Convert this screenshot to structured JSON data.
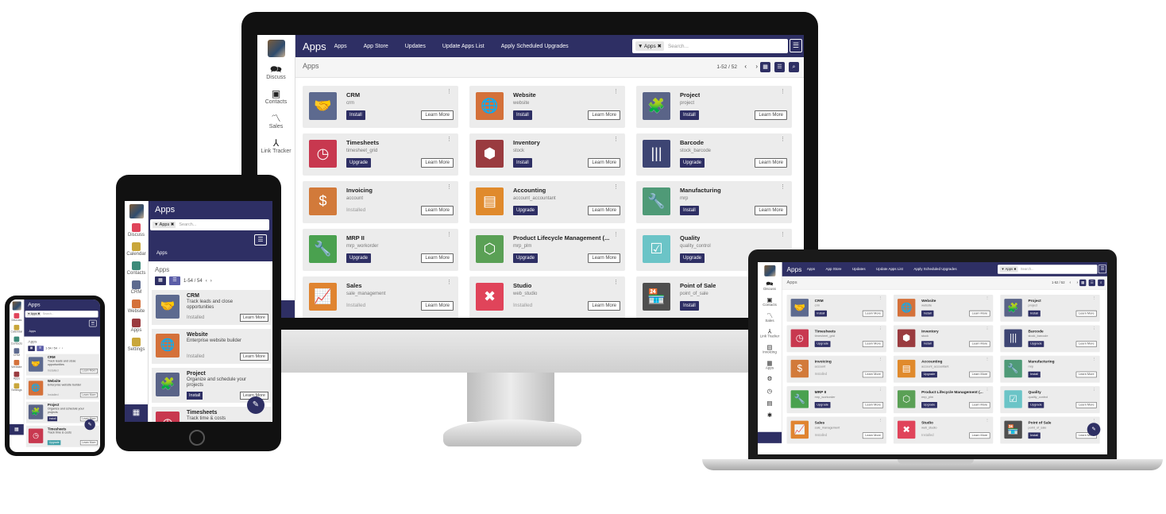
{
  "desktop": {
    "brand": "Apps",
    "nav": [
      "Apps",
      "App Store",
      "Updates",
      "Update Apps List",
      "Apply Scheduled Upgrades"
    ],
    "search_facet": "▼ Apps ✖",
    "search_placeholder": "Search...",
    "breadcrumb": "Apps",
    "pager": "1-52 / 52",
    "sidebar": [
      {
        "label": "Discuss",
        "icon": "discuss-icon",
        "glyph": "🗪"
      },
      {
        "label": "Contacts",
        "icon": "contacts-icon",
        "glyph": "▣"
      },
      {
        "label": "Sales",
        "icon": "sales-icon",
        "glyph": "〽"
      },
      {
        "label": "Link Tracker",
        "icon": "link-tracker-icon",
        "glyph": "⅄"
      }
    ],
    "cards": [
      {
        "name": "CRM",
        "tech": "crm",
        "action": "Install",
        "color": "#5d6a8f",
        "glyph": "🤝"
      },
      {
        "name": "Website",
        "tech": "website",
        "action": "Install",
        "color": "#d4713a",
        "glyph": "🌐"
      },
      {
        "name": "Project",
        "tech": "project",
        "action": "Install",
        "color": "#5a6488",
        "glyph": "🧩"
      },
      {
        "name": "Timesheets",
        "tech": "timesheet_grid",
        "action": "Upgrade",
        "color": "#c8384f",
        "glyph": "◷"
      },
      {
        "name": "Inventory",
        "tech": "stock",
        "action": "Install",
        "color": "#9a3b3f",
        "glyph": "⬢"
      },
      {
        "name": "Barcode",
        "tech": "stock_barcode",
        "action": "Upgrade",
        "color": "#3d4573",
        "glyph": "|||"
      },
      {
        "name": "Invoicing",
        "tech": "account",
        "action": "Installed",
        "color": "#d27a3a",
        "glyph": "$"
      },
      {
        "name": "Accounting",
        "tech": "account_accountant",
        "action": "Upgrade",
        "color": "#e08a2c",
        "glyph": "▤"
      },
      {
        "name": "Manufacturing",
        "tech": "mrp",
        "action": "Install",
        "color": "#4f9a77",
        "glyph": "🔧"
      },
      {
        "name": "MRP II",
        "tech": "mrp_workorder",
        "action": "Upgrade",
        "color": "#4aa14f",
        "glyph": "🔧"
      },
      {
        "name": "Product Lifecycle Management (...",
        "tech": "mrp_plm",
        "action": "Upgrade",
        "color": "#5aa055",
        "glyph": "⬡"
      },
      {
        "name": "Quality",
        "tech": "quality_control",
        "action": "Upgrade",
        "color": "#6bc4c7",
        "glyph": "☑"
      },
      {
        "name": "Sales",
        "tech": "sale_management",
        "action": "Installed",
        "color": "#e08430",
        "glyph": "📈"
      },
      {
        "name": "Studio",
        "tech": "web_studio",
        "action": "Installed",
        "color": "#e0445a",
        "glyph": "✖"
      },
      {
        "name": "Point of Sale",
        "tech": "point_of_sale",
        "action": "Install",
        "color": "#4f4f4f",
        "glyph": "🏪"
      }
    ],
    "learn_more": "Learn More"
  },
  "laptop": {
    "brand": "Apps",
    "nav": [
      "Apps",
      "App Store",
      "Updates",
      "Update Apps List",
      "Apply Scheduled Upgrades"
    ],
    "search_facet": "▼ Apps ✖",
    "search_placeholder": "Search...",
    "breadcrumb": "Apps",
    "pager": "1-52 / 52",
    "sidebar": [
      {
        "label": "Discuss",
        "icon": "discuss-icon",
        "glyph": "🗪"
      },
      {
        "label": "Contacts",
        "icon": "contacts-icon",
        "glyph": "▣"
      },
      {
        "label": "Sales",
        "icon": "sales-icon",
        "glyph": "〽"
      },
      {
        "label": "Link Tracker",
        "icon": "link-tracker-icon",
        "glyph": "⅄"
      },
      {
        "label": "Invoicing",
        "icon": "invoicing-icon",
        "glyph": "▤"
      },
      {
        "label": "Apps",
        "icon": "apps-icon",
        "glyph": "▦"
      },
      {
        "label": "",
        "icon": "settings-icon",
        "glyph": "⚙"
      },
      {
        "label": "",
        "icon": "clock-icon",
        "glyph": "◷"
      },
      {
        "label": "",
        "icon": "notes-icon",
        "glyph": "▤"
      },
      {
        "label": "",
        "icon": "gear-icon",
        "glyph": "✱"
      }
    ]
  },
  "tablet": {
    "brand": "Apps",
    "search_facet": "▼ Apps ✖",
    "search_placeholder": "Search...",
    "sub": "Apps",
    "breadcrumb": "Apps",
    "pager": "1-54 / 54",
    "sidebar": [
      {
        "label": "Discuss",
        "color": "#e0445a"
      },
      {
        "label": "Calendar",
        "color": "#c9a63a"
      },
      {
        "label": "Contacts",
        "color": "#3d8b7a"
      },
      {
        "label": "CRM",
        "color": "#5d6a8f"
      },
      {
        "label": "Website",
        "color": "#d4713a"
      },
      {
        "label": "Apps",
        "color": "#9a3b3f"
      },
      {
        "label": "Settings",
        "color": "#c9a63a"
      }
    ],
    "cards": [
      {
        "name": "CRM",
        "summary": "Track leads and close opportunities",
        "action": "Installed",
        "color": "#5d6a8f",
        "glyph": "🤝"
      },
      {
        "name": "Website",
        "summary": "Enterprise website builder",
        "action": "Installed",
        "color": "#d4713a",
        "glyph": "🌐"
      },
      {
        "name": "Project",
        "summary": "Organize and schedule your projects",
        "action": "Install",
        "color": "#5a6488",
        "glyph": "🧩"
      },
      {
        "name": "Timesheets",
        "summary": "Track time & costs",
        "action": "Upgrade",
        "color": "#c8384f",
        "glyph": "◷"
      }
    ],
    "learn_more": "Learn More"
  },
  "phone": {
    "brand": "Apps",
    "search_facet": "▼ Apps ✖",
    "search_placeholder": "Search...",
    "sub": "Apps",
    "breadcrumb": "Apps",
    "pager": "1-54 / 54",
    "sidebar": [
      {
        "label": "Discuss",
        "color": "#e0445a"
      },
      {
        "label": "Calendar",
        "color": "#c9a63a"
      },
      {
        "label": "Contacts",
        "color": "#3d8b7a"
      },
      {
        "label": "CRM",
        "color": "#5d6a8f"
      },
      {
        "label": "Website",
        "color": "#d4713a"
      },
      {
        "label": "Apps",
        "color": "#9a3b3f"
      },
      {
        "label": "Settings",
        "color": "#c9a63a"
      }
    ],
    "cards": [
      {
        "name": "CRM",
        "summary": "Track leads and close opportunities",
        "action": "Installed",
        "color": "#5d6a8f",
        "glyph": "🤝"
      },
      {
        "name": "Website",
        "summary": "Enterprise website builder",
        "action": "Installed",
        "color": "#d4713a",
        "glyph": "🌐"
      },
      {
        "name": "Project",
        "summary": "Organize and schedule your projects",
        "action": "Install",
        "color": "#5a6488",
        "glyph": "🧩"
      },
      {
        "name": "Timesheets",
        "summary": "Track time & costs",
        "action": "Upgrade",
        "color": "#c8384f",
        "glyph": "◷"
      }
    ],
    "learn_more": "Learn More"
  },
  "colors": {
    "brand": "#2e2f64",
    "card": "#ececec"
  }
}
